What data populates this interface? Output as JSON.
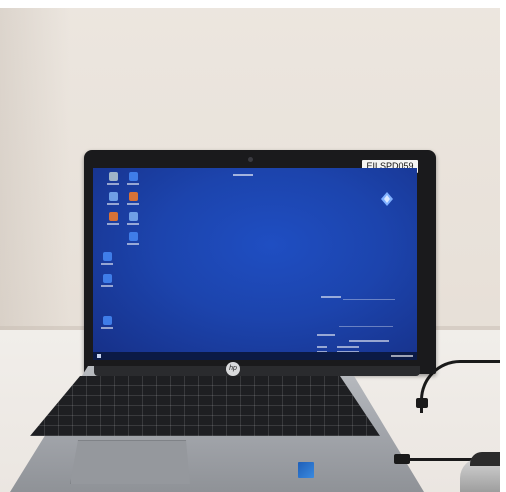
{
  "photo": {
    "subject": "laptop-on-desk",
    "asset_tag": "EILSPD059",
    "brand_mark": "hp",
    "colors": {
      "wall": "#ece6df",
      "desk": "#f1eeea",
      "screen": "#1c44ad",
      "bezel": "#1a1a1c",
      "chassis": "#a7aab0",
      "keyboard": "#1e1f22"
    }
  },
  "desktop": {
    "icons": [
      {
        "icon": "recycle-bin-icon"
      },
      {
        "icon": "h-app-icon"
      },
      {
        "icon": "user-folder-icon"
      },
      {
        "icon": "network-app-icon"
      },
      {
        "icon": "app-icon"
      },
      {
        "icon": "document-icon"
      },
      {
        "icon": "h-app-icon"
      },
      {
        "icon": "network-app-icon"
      },
      {
        "icon": "network-app-icon"
      },
      {
        "icon": "network-app-icon"
      }
    ],
    "corner_logo_icon": "diamond-logo-icon",
    "taskbar": {
      "start_icon": "windows-start-icon"
    }
  }
}
